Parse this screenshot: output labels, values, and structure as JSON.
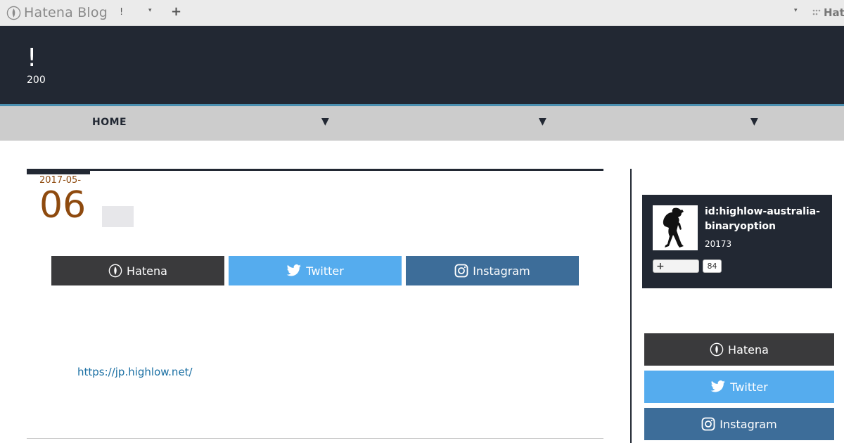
{
  "topbar": {
    "logo_text": "Hatena Blog",
    "notice": "!",
    "caret": "▾",
    "add": "+",
    "right_brand": "Hat"
  },
  "header": {
    "site_title": "!",
    "site_desc": "200"
  },
  "nav": {
    "home": "HOME",
    "arrows": [
      "▼",
      "▼",
      "▼"
    ]
  },
  "entry": {
    "date_ym": "2017-05-",
    "date_day": "06",
    "link_text": "https://jp.highlow.net/"
  },
  "share": {
    "hatena": "Hatena",
    "twitter": "Twitter",
    "instagram": "Instagram"
  },
  "profile": {
    "id": "id:highlow-australia-binaryoption",
    "count": "20173",
    "follow_count": "84"
  },
  "colors": {
    "header_bg": "#222833",
    "accent": "#4a8fb0",
    "date_color": "#8e4a0e",
    "hatena_bg": "#3a3a3c",
    "twitter_bg": "#55acee",
    "instagram_bg": "#3d6d99",
    "link_color": "#1a6fa3"
  }
}
